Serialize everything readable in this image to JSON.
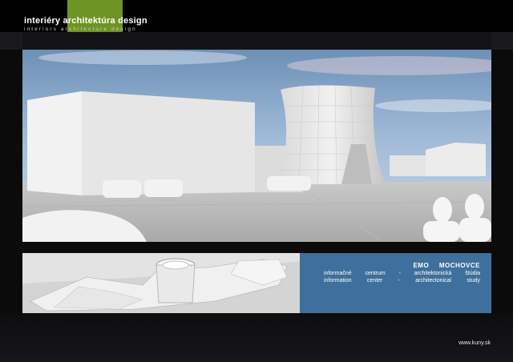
{
  "brand": {
    "line1_words": [
      "interiéry",
      "architektúra",
      "design"
    ],
    "line2": "interiors   architecture   design"
  },
  "info": {
    "title": "EMO MOCHOVCE",
    "line_sk": "informačné centrum - architektonická štúdia",
    "line_en": "information center - architectonical study"
  },
  "footer": {
    "website": "www.kuny.sk"
  },
  "colors": {
    "accent_green": "#6d9424",
    "info_blue": "#3f6f9c"
  }
}
